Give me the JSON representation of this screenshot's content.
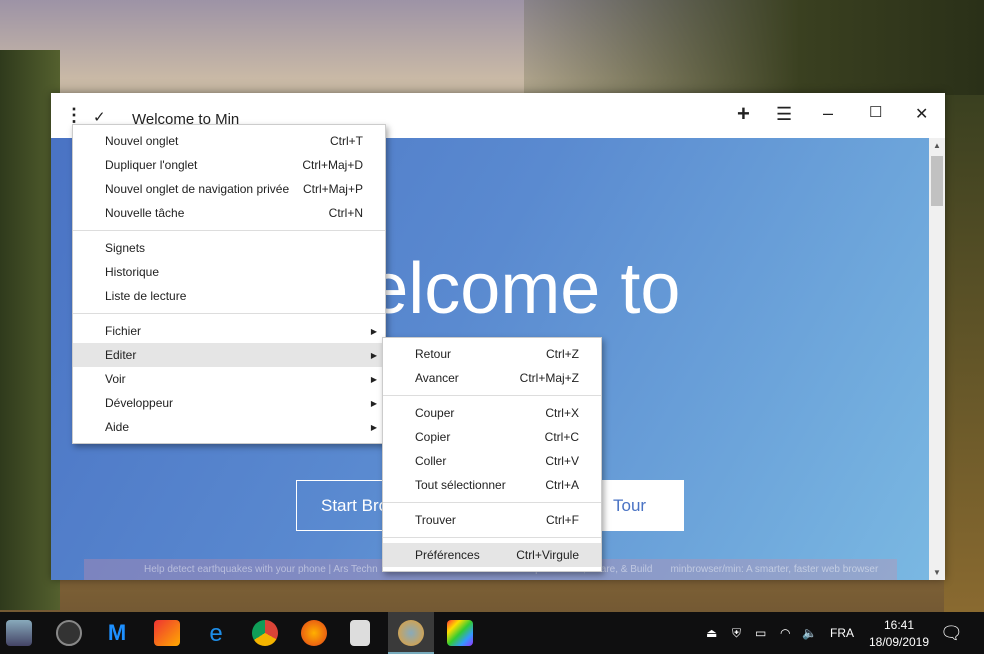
{
  "window": {
    "title": "Welcome to Min",
    "new_tab_icon": "plus-icon",
    "tasks_icon": "hamburger-icon"
  },
  "page": {
    "heading": "Welcome to",
    "start_button": "Start Bro",
    "tour_button": "Tour"
  },
  "background_tabs": [
    "Help detect earthquakes with your phone | Ars Techn",
    "Stack Overflow - Where Developers Learn, Share, & Build",
    "minbrowser/min: A smarter, faster web browser"
  ],
  "menu": {
    "items": [
      {
        "label": "Nouvel onglet",
        "shortcut": "Ctrl+T"
      },
      {
        "label": "Dupliquer l'onglet",
        "shortcut": "Ctrl+Maj+D"
      },
      {
        "label": "Nouvel onglet de navigation privée",
        "shortcut": "Ctrl+Maj+P"
      },
      {
        "label": "Nouvelle tâche",
        "shortcut": "Ctrl+N"
      },
      {
        "label": "Signets"
      },
      {
        "label": "Historique"
      },
      {
        "label": "Liste de lecture"
      },
      {
        "label": "Fichier"
      },
      {
        "label": "Editer"
      },
      {
        "label": "Voir"
      },
      {
        "label": "Développeur"
      },
      {
        "label": "Aide"
      }
    ]
  },
  "submenu": {
    "items": [
      {
        "label": "Retour",
        "shortcut": "Ctrl+Z"
      },
      {
        "label": "Avancer",
        "shortcut": "Ctrl+Maj+Z"
      },
      {
        "label": "Couper",
        "shortcut": "Ctrl+X"
      },
      {
        "label": "Copier",
        "shortcut": "Ctrl+C"
      },
      {
        "label": "Coller",
        "shortcut": "Ctrl+V"
      },
      {
        "label": "Tout sélectionner",
        "shortcut": "Ctrl+A"
      },
      {
        "label": "Trouver",
        "shortcut": "Ctrl+F"
      },
      {
        "label": "Préférences",
        "shortcut": "Ctrl+Virgule"
      }
    ]
  },
  "taskbar": {
    "language": "FRA",
    "time": "16:41",
    "date": "18/09/2019"
  }
}
